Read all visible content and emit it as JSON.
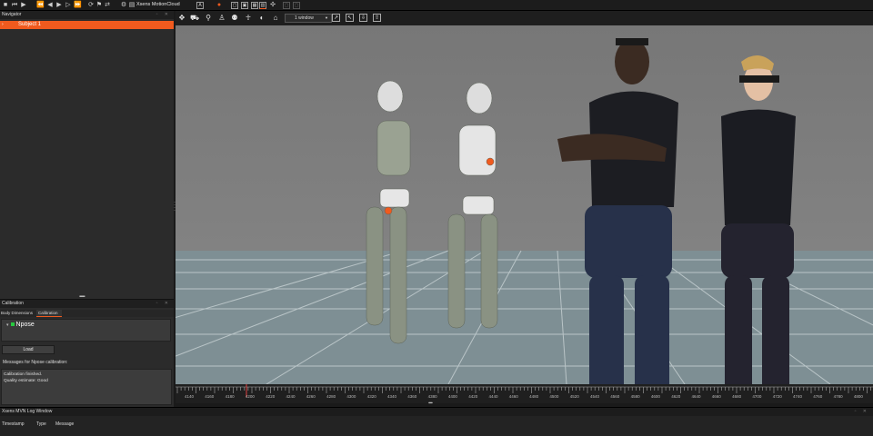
{
  "toolbar": {
    "doc_title": "Xsens MotionCloud",
    "icons": [
      "stop-icon",
      "rewind-icon",
      "step-back-icon",
      "play-icon",
      "step-forward-icon",
      "fast-forward-icon",
      "loop-icon",
      "flag-icon",
      "link-icon",
      "save-icon",
      "record-icon",
      "layout-a-icon",
      "layout-b-icon",
      "layout-c-icon",
      "layout-d-icon",
      "network-icon",
      "box-icon",
      "box2-icon"
    ]
  },
  "navigator": {
    "title": "Navigator",
    "subject_label": "Subject 1"
  },
  "calibration": {
    "title": "Calibration",
    "tabs": [
      "Body Dimensions",
      "Calibration"
    ],
    "active_tab": 1,
    "pose_name": "Npose",
    "load_label": "Load",
    "messages_title": "Messages for Npose calibration:",
    "messages": [
      "Calibration finished.",
      "Quality estimate: Good"
    ]
  },
  "viewport": {
    "window_option": "1 window"
  },
  "timeline": {
    "frames": [
      "4140",
      "4160",
      "4180",
      "4200",
      "4220",
      "4240",
      "4260",
      "4280",
      "4300",
      "4320",
      "4340",
      "4360",
      "4380",
      "4400",
      "4420",
      "4440",
      "4460",
      "4480",
      "4500",
      "4520",
      "4540",
      "4560",
      "4580",
      "4600",
      "4620",
      "4640",
      "4660",
      "4680",
      "4700",
      "4720",
      "4740",
      "4760",
      "4780",
      "4800"
    ]
  },
  "log": {
    "title": "Xsens MVN Log Window",
    "columns": [
      "Timestamp",
      "Type",
      "Message"
    ]
  },
  "colors": {
    "accent": "#f05a1e",
    "panel": "#2b2b2b",
    "viewport_bg": "#7a7a7a",
    "status_green": "#27c93f"
  }
}
